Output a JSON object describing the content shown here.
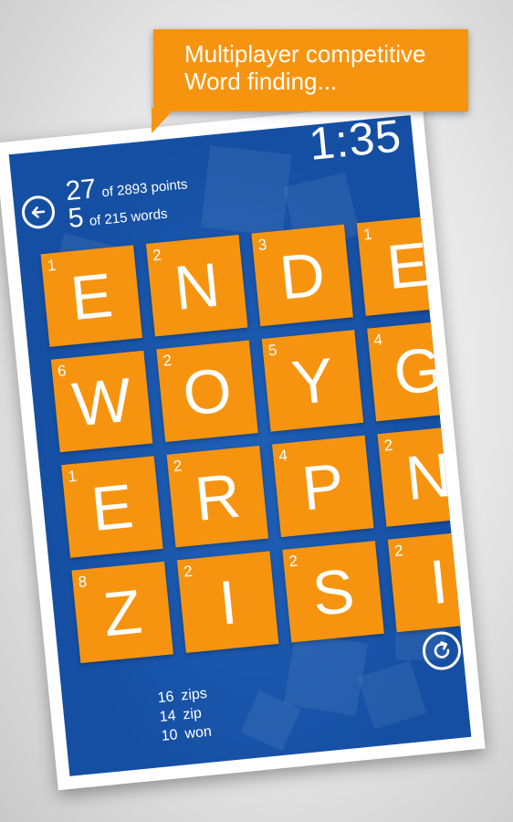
{
  "promo": {
    "line1": "Multiplayer competitive",
    "line2": "Word finding..."
  },
  "game": {
    "timer": "1:35",
    "points_value": "27",
    "points_label": "of 2893 points",
    "words_value": "5",
    "words_label": "of 215 words",
    "back_icon": "back-arrow-icon",
    "refresh_icon": "refresh-icon",
    "tiles": [
      {
        "letter": "E",
        "score": "1"
      },
      {
        "letter": "N",
        "score": "2"
      },
      {
        "letter": "D",
        "score": "3"
      },
      {
        "letter": "E",
        "score": "1"
      },
      {
        "letter": "W",
        "score": "6"
      },
      {
        "letter": "O",
        "score": "2"
      },
      {
        "letter": "Y",
        "score": "5"
      },
      {
        "letter": "G",
        "score": "4"
      },
      {
        "letter": "E",
        "score": "1"
      },
      {
        "letter": "R",
        "score": "2"
      },
      {
        "letter": "P",
        "score": "4"
      },
      {
        "letter": "N",
        "score": "2"
      },
      {
        "letter": "Z",
        "score": "8"
      },
      {
        "letter": "I",
        "score": "2"
      },
      {
        "letter": "S",
        "score": "2"
      },
      {
        "letter": "I",
        "score": "2"
      }
    ],
    "found_words": [
      {
        "points": "16",
        "word": "zips"
      },
      {
        "points": "14",
        "word": "zip"
      },
      {
        "points": "10",
        "word": "won"
      }
    ]
  },
  "colors": {
    "accent_orange": "#f7940f",
    "board_blue": "#154fa3",
    "text": "#ffffff"
  }
}
